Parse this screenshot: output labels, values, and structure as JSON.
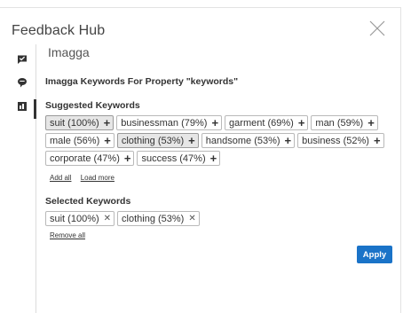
{
  "header": {
    "title": "Feedback Hub"
  },
  "rail": {
    "icons": [
      "feedback-chat-icon",
      "comment-icon",
      "keywords-icon"
    ]
  },
  "section": {
    "title": "Imagga"
  },
  "keywords_heading": "Imagga Keywords For Property \"keywords\"",
  "suggested": {
    "heading": "Suggested Keywords",
    "chips": [
      {
        "label": "suit (100%)",
        "selected": true
      },
      {
        "label": "businessman (79%)",
        "selected": false
      },
      {
        "label": "garment (69%)",
        "selected": false
      },
      {
        "label": "man (59%)",
        "selected": false
      },
      {
        "label": "male (56%)",
        "selected": false
      },
      {
        "label": "clothing (53%)",
        "selected": true
      },
      {
        "label": "handsome (53%)",
        "selected": false
      },
      {
        "label": "business (52%)",
        "selected": false
      },
      {
        "label": "corporate (47%)",
        "selected": false
      },
      {
        "label": "success (47%)",
        "selected": false
      }
    ],
    "add_all": "Add all",
    "load_more": "Load more"
  },
  "selected_section": {
    "heading": "Selected Keywords",
    "chips": [
      {
        "label": "suit (100%)"
      },
      {
        "label": "clothing (53%)"
      }
    ],
    "remove_all": "Remove all"
  },
  "apply_label": "Apply",
  "colors": {
    "accent": "#1a73c8",
    "selected_chip_bg": "#e6e6e6",
    "text": "#333333"
  }
}
